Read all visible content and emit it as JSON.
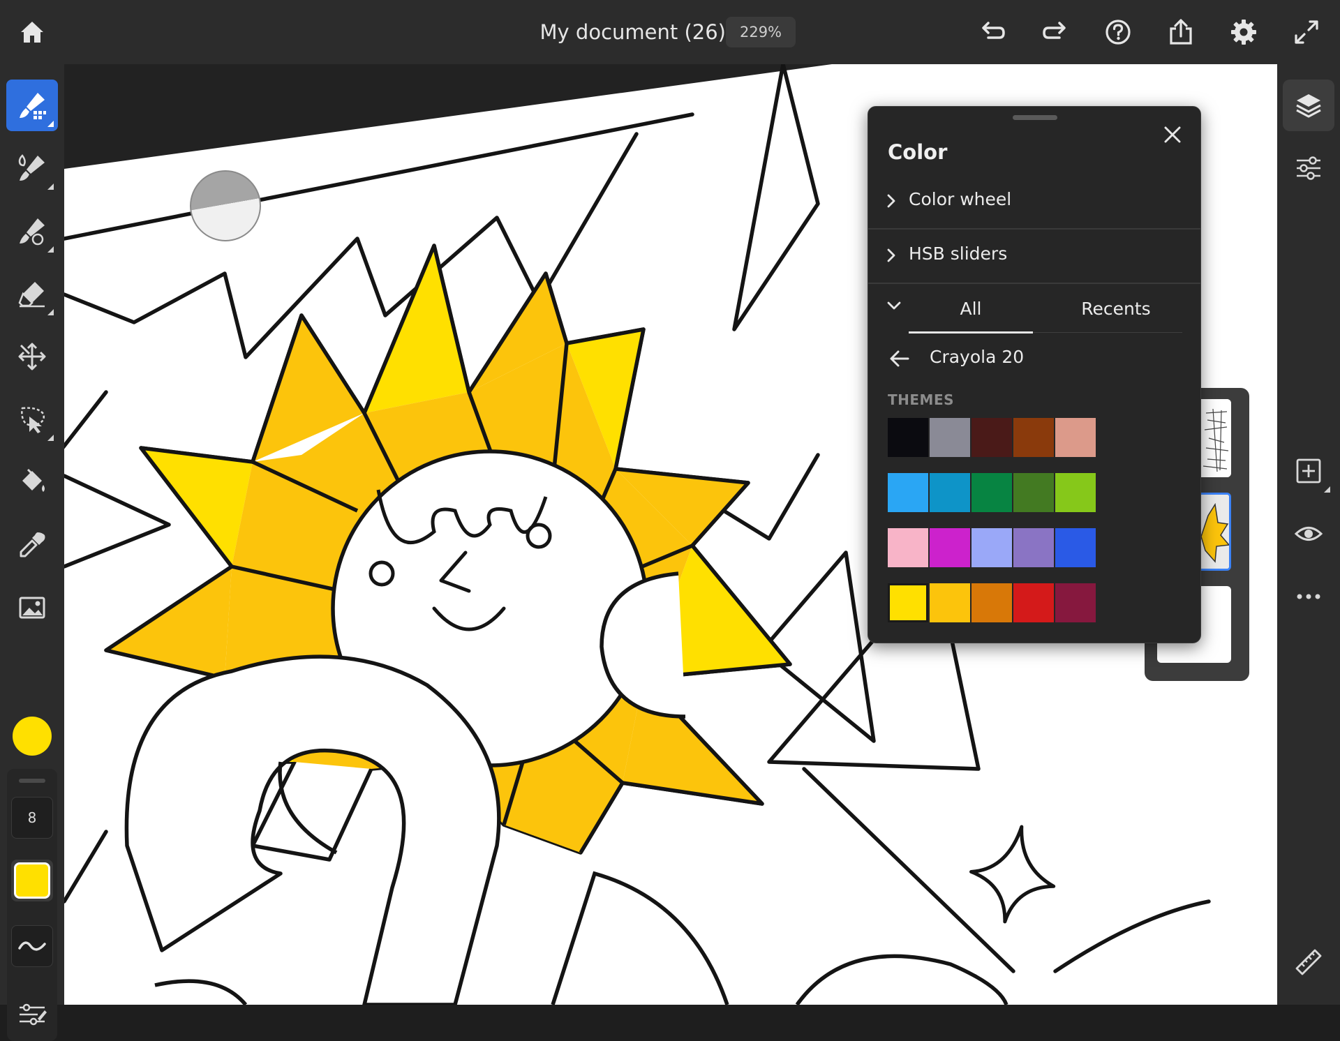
{
  "document": {
    "title": "My document (26)",
    "zoom": "229%"
  },
  "topbar": {
    "icons": [
      "home-icon",
      "undo-icon",
      "redo-icon",
      "help-icon",
      "share-icon",
      "gear-icon",
      "fullscreen-icon"
    ]
  },
  "toolbar_left": {
    "tools": [
      "pixel-brush-icon",
      "live-brush-icon",
      "vector-brush-icon",
      "eraser-icon",
      "transform-icon",
      "selection-icon",
      "fill-icon",
      "eyedropper-icon",
      "image-icon"
    ],
    "active_tool": "pixel-brush-icon",
    "current_color": "#ffe000",
    "brush_size": "8"
  },
  "toolbar_right": {
    "icons": [
      "layers-icon",
      "layer-properties-icon",
      "add-layer-icon",
      "visibility-icon",
      "more-icon",
      "ruler-icon"
    ]
  },
  "color_panel": {
    "title": "Color",
    "sections": [
      {
        "label": "Color wheel"
      },
      {
        "label": "HSB sliders"
      }
    ],
    "tabs": [
      {
        "label": "All",
        "active": true
      },
      {
        "label": "Recents",
        "active": false
      }
    ],
    "library": "Crayola 20",
    "themes_label": "THEMES",
    "swatches": [
      [
        "#0b0b10",
        "#8a8a96",
        "#4a1a18",
        "#8a3a0c",
        "#dc9a8a"
      ],
      [
        "#2aa6f4",
        "#0e94c8",
        "#078442",
        "#437a22",
        "#86c81a"
      ],
      [
        "#f8b4c8",
        "#cc22cc",
        "#9aa8f8",
        "#8a74c4",
        "#2a5ae6"
      ],
      [
        "#ffe000",
        "#fcc40c",
        "#d87808",
        "#d41a1a",
        "#86183e"
      ]
    ],
    "selected_swatch": "#ffe000"
  },
  "colors": {
    "accent": "#2f6fde",
    "sun_yellow": "#ffe000",
    "sun_gold": "#fcc40c"
  }
}
